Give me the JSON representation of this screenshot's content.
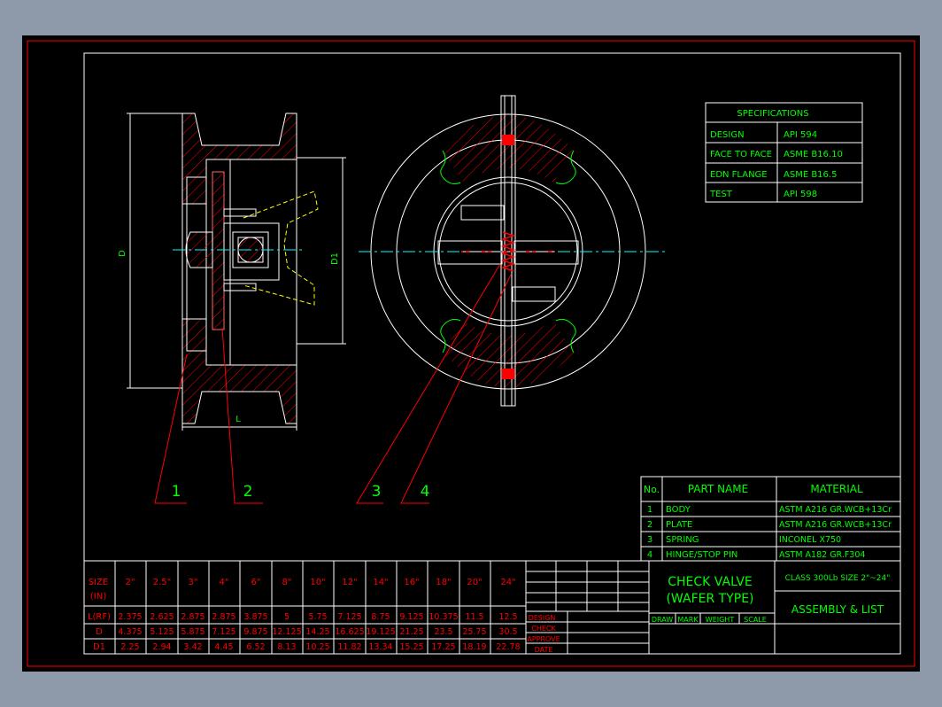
{
  "colors": {
    "background": "#8e9aaa",
    "sheet": "#000000",
    "border": "#ff0000",
    "frame": "#ffffff",
    "text_green": "#00ff00",
    "text_red": "#ff0000",
    "hatch": "#ff0000",
    "centerline": "#00ffff",
    "hidden": "#ffff00"
  },
  "views": {
    "side_labels": {
      "d": "D",
      "d1": "D1",
      "l": "L"
    },
    "balloons": [
      "1",
      "2",
      "3",
      "4"
    ]
  },
  "specs": {
    "title": "SPECIFICATIONS",
    "rows": [
      {
        "k": "DESIGN",
        "v": "API 594"
      },
      {
        "k": "FACE TO FACE",
        "v": "ASME B16.10"
      },
      {
        "k": "EDN FLANGE",
        "v": "ASME B16.5"
      },
      {
        "k": "TEST",
        "v": "API 598"
      }
    ]
  },
  "parts": {
    "headers": {
      "no": "No.",
      "name": "PART NAME",
      "material": "MATERIAL"
    },
    "rows": [
      {
        "no": "1",
        "name": "BODY",
        "material": "ASTM A216 GR.WCB+13Cr"
      },
      {
        "no": "2",
        "name": "PLATE",
        "material": "ASTM A216 GR.WCB+13Cr"
      },
      {
        "no": "3",
        "name": "SPRING",
        "material": "INCONEL X750"
      },
      {
        "no": "4",
        "name": "HINGE/STOP PIN",
        "material": "ASTM A182 GR.F304"
      }
    ]
  },
  "sizes": {
    "header": [
      "SIZE",
      "(IN)"
    ],
    "sizes": [
      "2\"",
      "2.5\"",
      "3\"",
      "4\"",
      "6\"",
      "8\"",
      "10\"",
      "12\"",
      "14\"",
      "16\"",
      "18\"",
      "20\"",
      "24\""
    ],
    "rows": [
      {
        "label": "L(RF)",
        "values": [
          "2.375",
          "2.625",
          "2.875",
          "2.875",
          "3.875",
          "5",
          "5.75",
          "7.125",
          "8.75",
          "9.125",
          "10.375",
          "11.5",
          "12.5"
        ]
      },
      {
        "label": "D",
        "values": [
          "4.375",
          "5.125",
          "5.875",
          "7.125",
          "9.875",
          "12.125",
          "14.25",
          "16.625",
          "19.125",
          "21.25",
          "23.5",
          "25.75",
          "30.5"
        ]
      },
      {
        "label": "D1",
        "values": [
          "2.25",
          "2.94",
          "3.42",
          "4.45",
          "6.52",
          "8.13",
          "10.25",
          "11.82",
          "13.34",
          "15.25",
          "17.25",
          "18.19",
          "22.78"
        ]
      }
    ]
  },
  "signoff": [
    "DESIGN",
    "CHECK",
    "APPROVE",
    "DATE"
  ],
  "title_block": {
    "title_line1": "CHECK VALVE",
    "title_line2": "(WAFER TYPE)",
    "class_size": "CLASS 300Lb SIZE 2\"~24\"",
    "drawing": "ASSEMBLY & LIST",
    "small": [
      "DRAW",
      "MARK",
      "WEIGHT",
      "SCALE"
    ]
  }
}
